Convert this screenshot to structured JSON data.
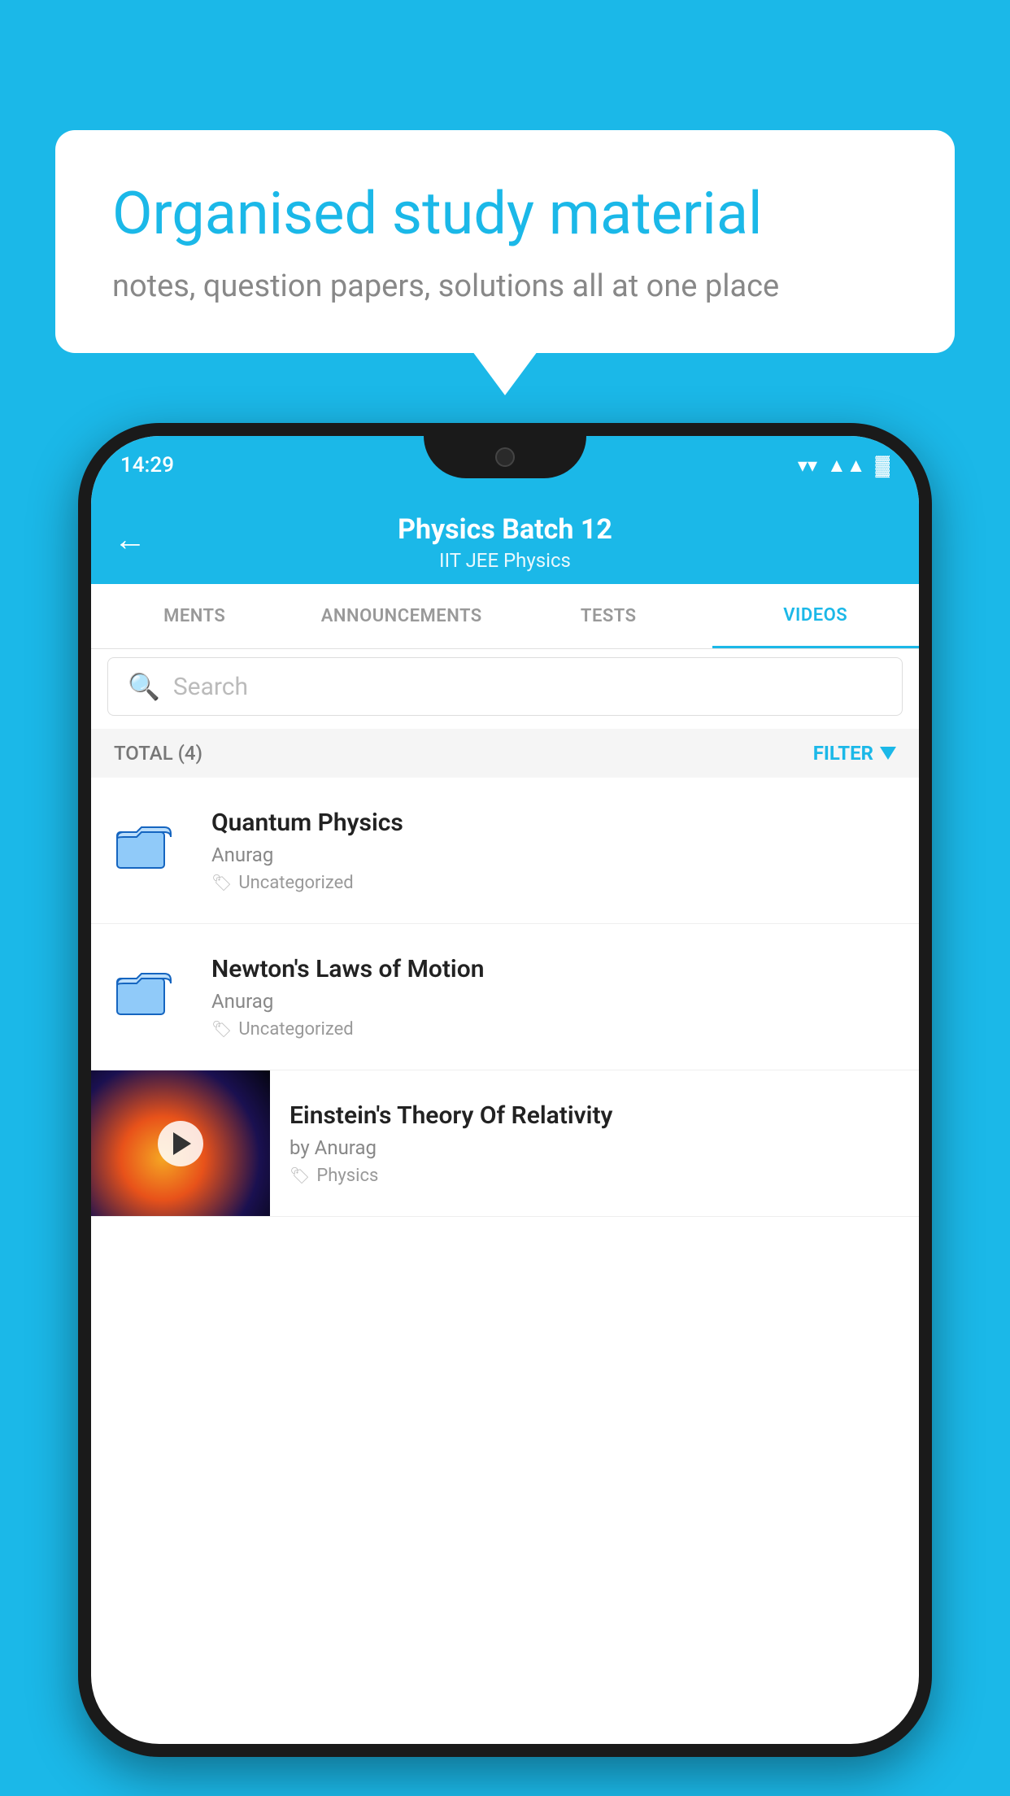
{
  "background": {
    "color": "#1BB8E8"
  },
  "speech_bubble": {
    "title": "Organised study material",
    "subtitle": "notes, question papers, solutions all at one place"
  },
  "status_bar": {
    "time": "14:29",
    "wifi": "▼",
    "signal": "▲",
    "battery": "▓"
  },
  "header": {
    "back_label": "←",
    "title": "Physics Batch 12",
    "subtitle": "IIT JEE   Physics"
  },
  "tabs": [
    {
      "label": "MENTS",
      "active": false
    },
    {
      "label": "ANNOUNCEMENTS",
      "active": false
    },
    {
      "label": "TESTS",
      "active": false
    },
    {
      "label": "VIDEOS",
      "active": true
    }
  ],
  "search": {
    "placeholder": "Search"
  },
  "filter_row": {
    "total_label": "TOTAL (4)",
    "filter_label": "FILTER"
  },
  "list_items": [
    {
      "title": "Quantum Physics",
      "author": "Anurag",
      "tag": "Uncategorized"
    },
    {
      "title": "Newton's Laws of Motion",
      "author": "Anurag",
      "tag": "Uncategorized"
    },
    {
      "title": "Einstein's Theory Of Relativity",
      "author": "by Anurag",
      "tag": "Physics",
      "has_thumbnail": true
    }
  ]
}
